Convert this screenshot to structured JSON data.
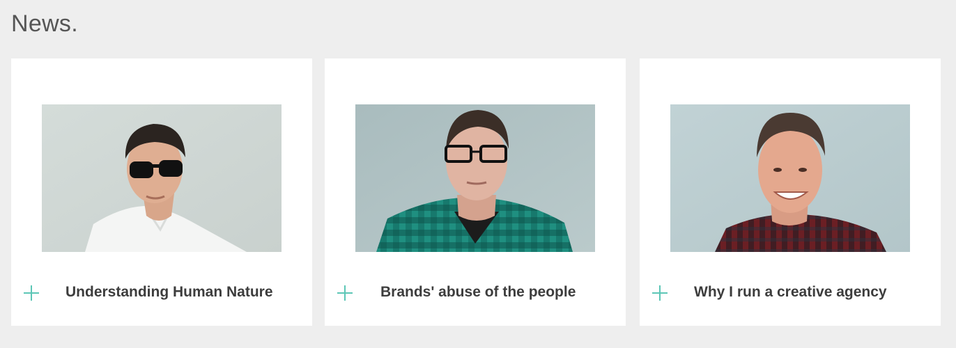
{
  "news": {
    "title": "News.",
    "accent_color": "#5cc6b6",
    "items": [
      {
        "title": "Understanding Human Nature",
        "icon": "plus-icon",
        "photo": "portrait of man in sunglasses and white shirt"
      },
      {
        "title": "Brands' abuse of the people",
        "icon": "plus-icon",
        "photo": "portrait of man in glasses and plaid shirt"
      },
      {
        "title": "Why I run a creative agency",
        "icon": "plus-icon",
        "photo": "portrait of smiling man in plaid shirt"
      }
    ]
  }
}
